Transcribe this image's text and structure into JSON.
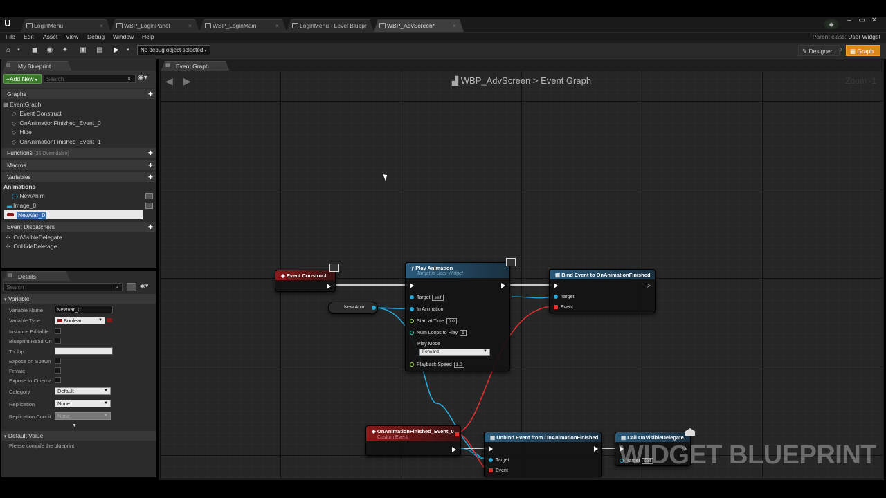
{
  "tabs": [
    {
      "label": "LoginMenu"
    },
    {
      "label": "WBP_LoginPanel"
    },
    {
      "label": "WBP_LoginMain"
    },
    {
      "label": "LoginMenu - Level Bluepr"
    },
    {
      "label": "WBP_AdvScreen*"
    }
  ],
  "menu": [
    "File",
    "Edit",
    "Asset",
    "View",
    "Debug",
    "Window",
    "Help"
  ],
  "parent_class": {
    "label": "Parent class:",
    "value": "User Widget"
  },
  "toolbar": {
    "debug_select": "No debug object selected",
    "designer": "Designer",
    "graph": "Graph"
  },
  "my_blueprint": {
    "tab": "My Blueprint",
    "add_new": "Add New",
    "search_placeholder": "Search",
    "graphs_header": "Graphs",
    "event_graph": "EventGraph",
    "events": [
      "Event Construct",
      "OnAnimationFinished_Event_0",
      "Hide",
      "OnAnimationFinished_Event_1"
    ],
    "functions_header": "Functions",
    "functions_note": "(36 Overridable)",
    "macros_header": "Macros",
    "variables_header": "Variables",
    "animations_header": "Animations",
    "new_anim": "NewAnim",
    "image_var": "Image_0",
    "new_var": "NewVar_0",
    "dispatchers_header": "Event Dispatchers",
    "dispatchers": [
      "OnVisibleDelegate",
      "OnHideDeletage"
    ]
  },
  "details": {
    "tab": "Details",
    "search_placeholder": "Search",
    "variable_header": "Variable",
    "variable_name_label": "Variable Name",
    "variable_name": "NewVar_0",
    "variable_type_label": "Variable Type",
    "variable_type": "Boolean",
    "instance_editable": "Instance Editable",
    "bp_read_only": "Blueprint Read On",
    "tooltip": "Tooltip",
    "expose_spawn": "Expose on Spawn",
    "private": "Private",
    "expose_cinema": "Expose to Cinema",
    "category_label": "Category",
    "category": "Default",
    "replication_label": "Replication",
    "replication": "None",
    "rep_cond_label": "Replication Condit",
    "rep_cond": "None",
    "default_header": "Default Value",
    "compile_note": "Please compile the blueprint"
  },
  "graph": {
    "tab": "Event Graph",
    "breadcrumb_bp": "WBP_AdvScreen",
    "breadcrumb_sep": ">",
    "breadcrumb_graph": "Event Graph",
    "zoom": "Zoom -1",
    "watermark": "WIDGET BLUEPRINT"
  },
  "nodes": {
    "event_construct": "Event Construct",
    "play_animation": {
      "title": "Play Animation",
      "subtitle": "Target is User Widget",
      "target": "Target",
      "self": "self",
      "in_animation": "In Animation",
      "start_at_time": "Start at Time",
      "start_val": "0.0",
      "num_loops": "Num Loops to Play",
      "loops_val": "1",
      "play_mode": "Play Mode",
      "play_mode_val": "Forward",
      "playback_speed": "Playback Speed",
      "speed_val": "1.0"
    },
    "new_anim": "New Anim",
    "bind_event": {
      "title": "Bind Event to OnAnimationFinished",
      "target": "Target",
      "event": "Event"
    },
    "on_anim_finished": {
      "title": "OnAnimationFinished_Event_0",
      "subtitle": "Custom Event"
    },
    "unbind_event": {
      "title": "Unbind Event from OnAnimationFinished",
      "target": "Target",
      "event": "Event"
    },
    "call_visible": {
      "title": "Call OnVisibleDelegate",
      "target": "Target",
      "self": "self"
    }
  },
  "colors": {
    "accent": "#d98a1a",
    "event_red": "#8a1a1a",
    "func_blue": "#2a5a7a",
    "exec_white": "#ffffff",
    "object_blue": "#2aa8d8",
    "delegate_red": "#e03030",
    "float_green": "#9ad84a"
  }
}
